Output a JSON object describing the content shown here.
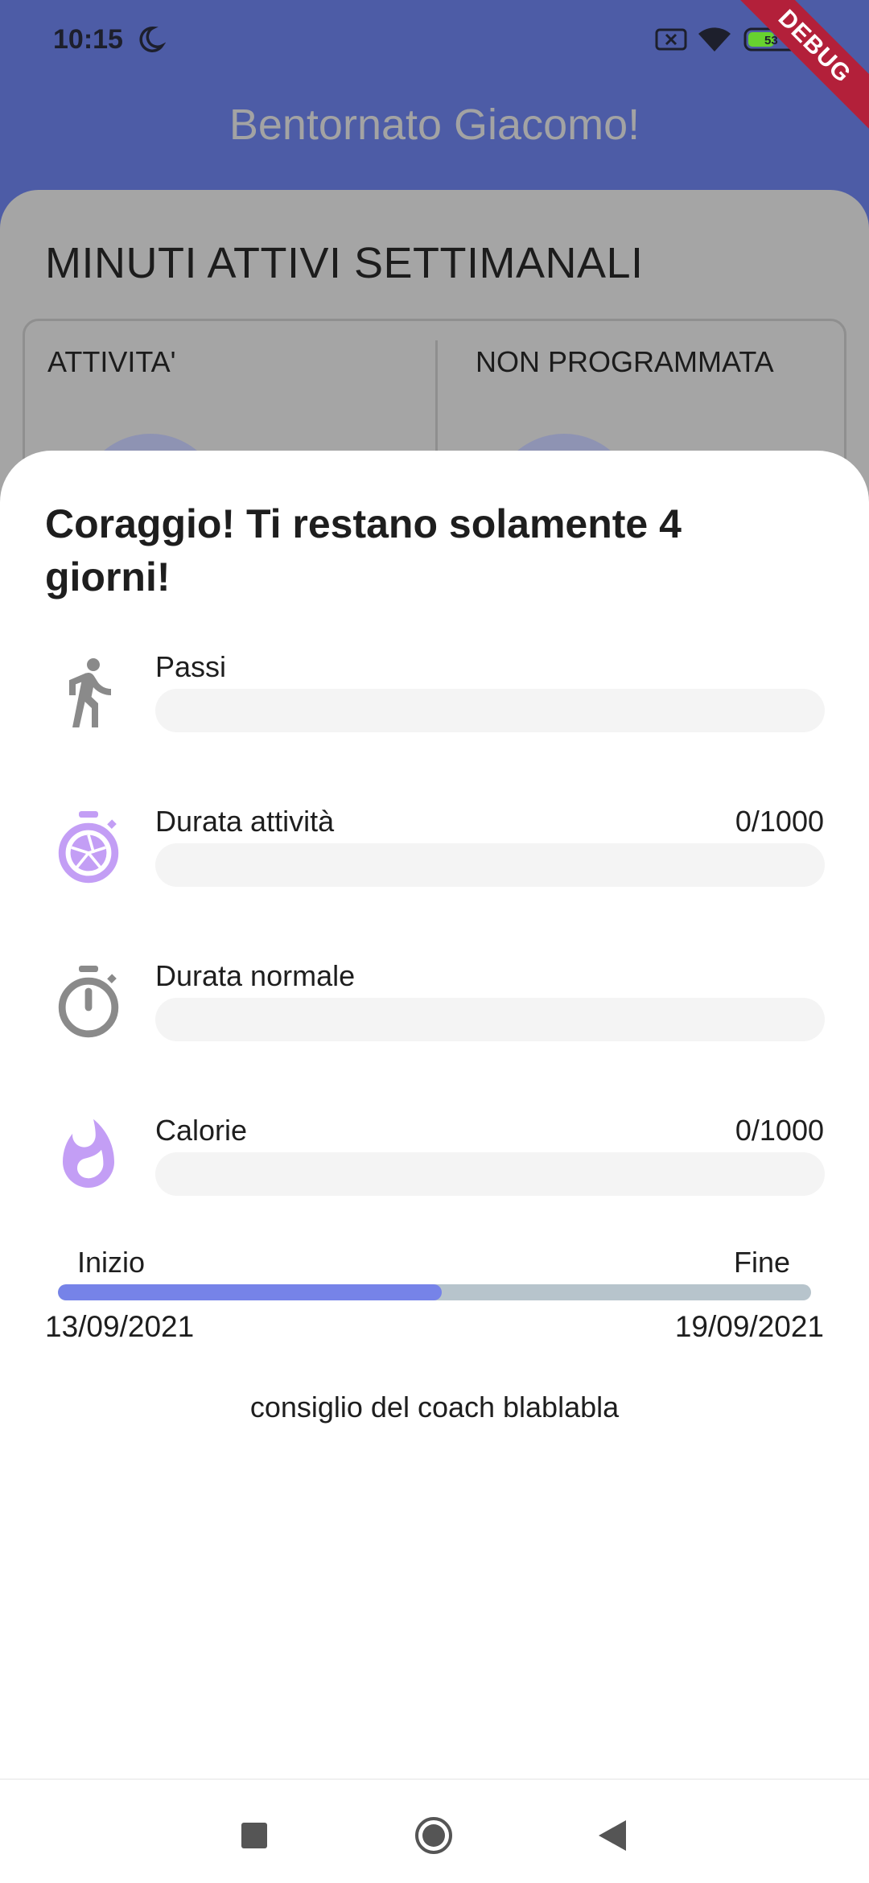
{
  "status_bar": {
    "time": "10:15",
    "battery_level": "53",
    "debug_label": "DEBUG",
    "icons": [
      "moon-icon",
      "sim-x-icon",
      "wifi-icon",
      "battery-icon"
    ]
  },
  "app_bar": {
    "title": "Bentornato Giacomo!"
  },
  "background_card": {
    "title": "MINUTI ATTIVI SETTIMANALI",
    "columns": [
      "ATTIVITA'",
      "NON PROGRAMMATA"
    ]
  },
  "sheet": {
    "title": "Coraggio! Ti restano solamente 4 giorni!",
    "metrics": [
      {
        "label": "Passi",
        "value": "",
        "icon": "walking-icon",
        "icon_color": "#8a8a8a",
        "progress": 0
      },
      {
        "label": "Durata attività",
        "value": "0/1000",
        "icon": "timer-aperture-icon",
        "icon_color": "#c39ef5",
        "progress": 0
      },
      {
        "label": "Durata normale",
        "value": "",
        "icon": "stopwatch-icon",
        "icon_color": "#8a8a8a",
        "progress": 0
      },
      {
        "label": "Calorie",
        "value": "0/1000",
        "icon": "flame-icon",
        "icon_color": "#c39ef5",
        "progress": 0
      }
    ],
    "range": {
      "start_label": "Inizio",
      "end_label": "Fine",
      "start_date": "13/09/2021",
      "end_date": "19/09/2021",
      "progress": 0.51
    },
    "coach_tip": "consiglio del coach blablabla"
  },
  "nav_bar": {
    "icons": [
      "recent-apps-icon",
      "home-icon",
      "back-icon"
    ]
  },
  "colors": {
    "app_bar": "#4d5ca6",
    "accent_purple": "#c39ef5",
    "progress_fill": "#7683e8",
    "progress_track": "#b7c4cc",
    "debug_ribbon": "#b3203a"
  }
}
